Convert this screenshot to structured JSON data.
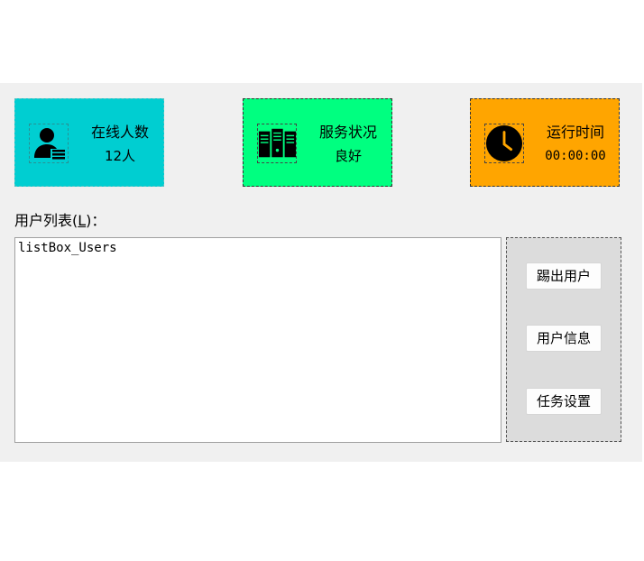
{
  "cards": {
    "online": {
      "title": "在线人数",
      "value": "12人",
      "color": "#00ced1",
      "icon": "user-list-icon"
    },
    "service": {
      "title": "服务状况",
      "value": "良好",
      "color": "#00ff80",
      "icon": "server-icon"
    },
    "uptime": {
      "title": "运行时间",
      "value": "00:00:00",
      "color": "#ffa500",
      "icon": "clock-icon"
    }
  },
  "user_list": {
    "label_prefix": "用户列表(",
    "label_mnemonic": "L",
    "label_suffix": ")：",
    "items": [
      "listBox_Users"
    ]
  },
  "buttons": {
    "kick": "踢出用户",
    "info": "用户信息",
    "task": "任务设置"
  }
}
